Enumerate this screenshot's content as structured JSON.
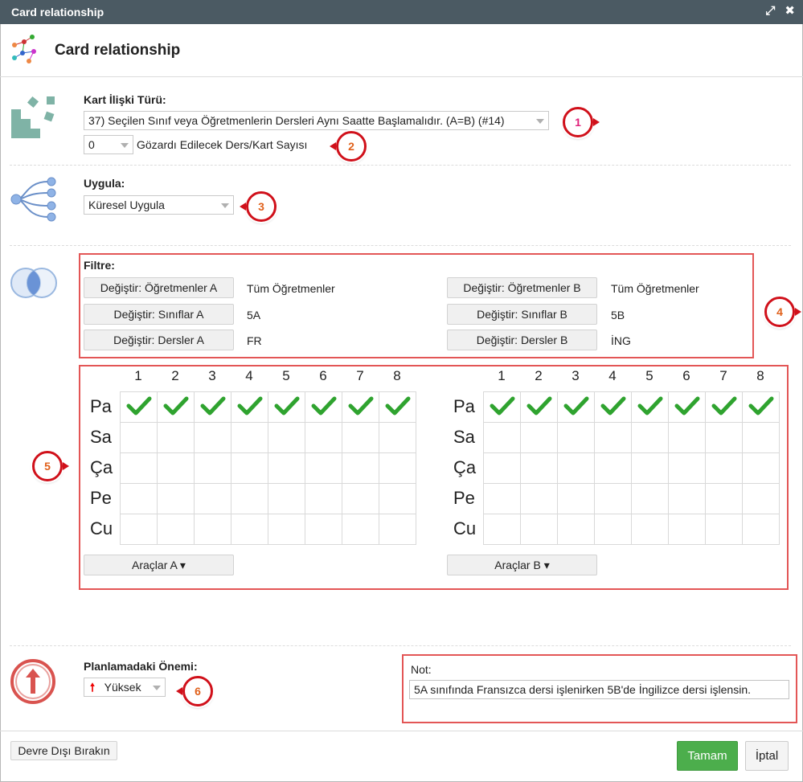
{
  "window": {
    "title": "Card relationship",
    "expand_icon": "expand-icon",
    "close_icon": "close-icon"
  },
  "header": {
    "title": "Card relationship"
  },
  "relation": {
    "label": "Kart İlişki Türü:",
    "type_value": "37) Seçilen Sınıf veya Öğretmenlerin Dersleri Aynı Saatte Başlamalıdır. (A=B) (#14)",
    "ignore_count": "0",
    "ignore_label": "Gözardı Edilecek Ders/Kart Sayısı"
  },
  "apply": {
    "label": "Uygula:",
    "value": "Küresel Uygula"
  },
  "filter": {
    "label": "Filtre:",
    "rows": [
      {
        "btn_a": "Değiştir: Öğretmenler A",
        "val_a": "Tüm Öğretmenler",
        "btn_b": "Değiştir: Öğretmenler B",
        "val_b": "Tüm Öğretmenler"
      },
      {
        "btn_a": "Değiştir: Sınıflar A",
        "val_a": "5A",
        "btn_b": "Değiştir: Sınıflar B",
        "val_b": "5B"
      },
      {
        "btn_a": "Değiştir: Dersler A",
        "val_a": "FR",
        "btn_b": "Değiştir: Dersler B",
        "val_b": "İNG"
      }
    ]
  },
  "timetable": {
    "periods": [
      "1",
      "2",
      "3",
      "4",
      "5",
      "6",
      "7",
      "8"
    ],
    "days": [
      "Pa",
      "Sa",
      "Ça",
      "Pe",
      "Cu"
    ],
    "checked_day_index": 0,
    "tools_a": "Araçlar A ▾",
    "tools_b": "Araçlar B ▾"
  },
  "importance": {
    "label": "Planlamadaki Önemi:",
    "value": "Yüksek"
  },
  "note": {
    "label": "Not:",
    "value": "5A sınıfında Fransızca dersi işlenirken 5B'de İngilizce dersi işlensin."
  },
  "footer": {
    "disable": "Devre Dışı Bırakın",
    "ok": "Tamam",
    "cancel": "İptal"
  },
  "badges": [
    "1",
    "2",
    "3",
    "4",
    "5",
    "6"
  ],
  "colors": {
    "accent_red": "#d0101a",
    "ok_green": "#4cae4c",
    "check_green": "#2fa32f",
    "titlebar": "#4b5a63"
  }
}
